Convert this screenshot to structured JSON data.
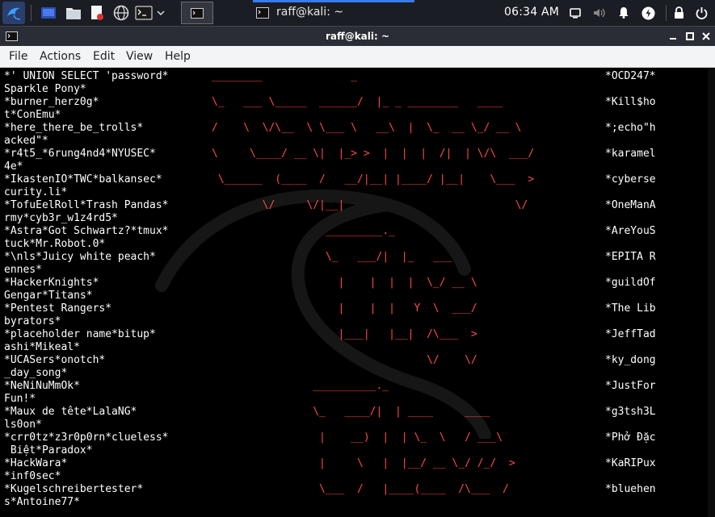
{
  "taskbar": {
    "icons": [
      "kali-dragon-icon",
      "desktop-icon",
      "file-manager-icon",
      "text-editor-icon",
      "browser-icon",
      "terminal-launcher-icon",
      "chevron-down-icon"
    ],
    "active_window_title": "raff@kali: ~",
    "clock": "06:34 AM",
    "tray_icons": [
      "display-icon",
      "volume-icon",
      "bell-icon",
      "power-manager-icon",
      "lock-icon",
      "power-icon"
    ]
  },
  "window": {
    "title": "raff@kali: ~",
    "controls": [
      "minimize",
      "maximize",
      "close"
    ]
  },
  "menu": {
    "items": [
      "File",
      "Actions",
      "Edit",
      "View",
      "Help"
    ]
  },
  "terminal": {
    "left_column": [
      "*' UNION SELECT 'password*",
      "Sparkle Pony*",
      "*burner_herz0g*",
      "t*ConEmu*",
      "*here_there_be_trolls*",
      "acked\"*",
      "*r4t5_*6rung4nd4*NYUSEC*",
      "4e*",
      "*IkastenIO*TWC*balkansec*",
      "curity.li*",
      "*TofuEelRoll*Trash Pandas*",
      "rmy*cyb3r_w1z4rd5*",
      "*Astra*Got Schwartz?*tmux*",
      "tuck*Mr.Robot.0*",
      "*\\nls*Juicy white peach*",
      "ennes*",
      "*HackerKnights*",
      "Gengar*Titans*",
      "*Pentest Rangers*",
      "byrators*",
      "*placeholder name*bitup*",
      "ashi*Mikeal*",
      "*UCASers*onotch*",
      "_day_song*",
      "*NeNiNuMmOk*",
      "Fun!*",
      "*Maux de tête*LalaNG*",
      "ls0on*",
      "*crr0tz*z3r0p0rn*clueless*",
      " Biệt*Paradox*",
      "*HackWara*",
      "*inf0sec*",
      "*Kugelschreibertester*",
      "s*Antoine77*"
    ],
    "right_column": [
      "*OCD247*",
      "",
      "*Kill$ho",
      "",
      "*;echo\"h",
      "",
      "*karamel",
      "",
      "*cyberse",
      "",
      "*OneManA",
      "",
      "*AreYouS",
      "",
      "*EPITA R",
      "",
      "*guildOf",
      "",
      "*The Lib",
      "",
      "*JeffTad",
      "",
      "*ky_dong",
      "",
      "*JustFor",
      "",
      "*g3tsh3L",
      "",
      "*Phở Đặc",
      "",
      "*KaRIPux",
      "",
      "*bluehen",
      ""
    ],
    "banner_lines": [
      "________              _",
      "\\_   ___ \\_____  ______/  |_ _ ________   ____",
      "/    \\  \\/\\__  \\ \\___ \\   __\\  |  \\_  __ \\_/ __ \\",
      "\\     \\____/ __ \\|  |_> >  |  |  |  /|  | \\/\\  ___/",
      " \\______  (____  /   __/|__| |____/ |__|    \\___  >",
      "        \\/     \\/|__|                           \\/",
      "                  _________._",
      "                  \\_   ___/|  |_   ___",
      "                    |    |  |  |  \\_/ __ \\",
      "                    |    |  |   Y  \\  ___/",
      "                    |___|   |__|  /\\___  >",
      "                                  \\/    \\/",
      "                __________._",
      "                \\_   ____/|  | ____     ____",
      "                 |    __)  |  | \\_  \\   / ___\\",
      "                 |     \\   |  |__/ __ \\_/ /_/  >",
      "                 \\___  /   |____(____  /\\___  /"
    ],
    "colors": {
      "text": "#ffffff",
      "banner": "#ff4a4a",
      "background": "#000000"
    }
  }
}
